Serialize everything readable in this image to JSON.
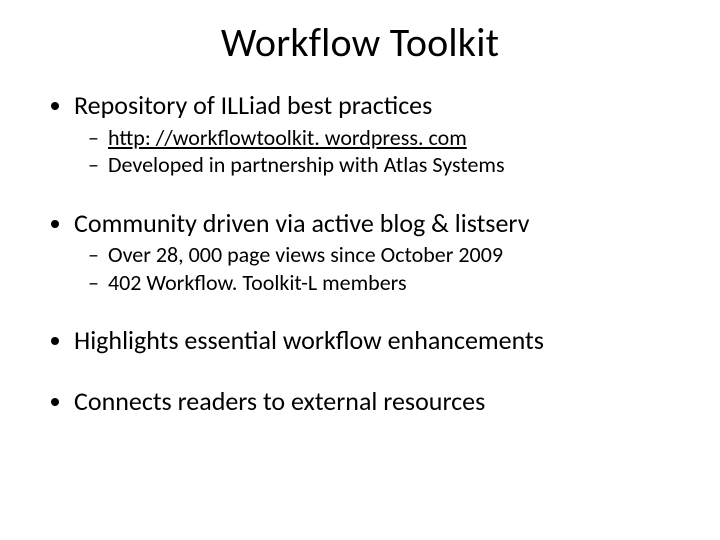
{
  "title": "Workflow Toolkit",
  "bullets": {
    "b0": {
      "text": "Repository of ILLiad best practices",
      "sub": {
        "s0": "http: //workflowtoolkit. wordpress. com",
        "s1": "Developed in partnership with Atlas Systems"
      }
    },
    "b1": {
      "text": "Community driven via active blog & listserv",
      "sub": {
        "s0": "Over 28, 000 page views since October 2009",
        "s1": "402 Workflow. Toolkit-L members"
      }
    },
    "b2": {
      "text": "Highlights essential workflow enhancements"
    },
    "b3": {
      "text": "Connects readers to external resources"
    }
  }
}
